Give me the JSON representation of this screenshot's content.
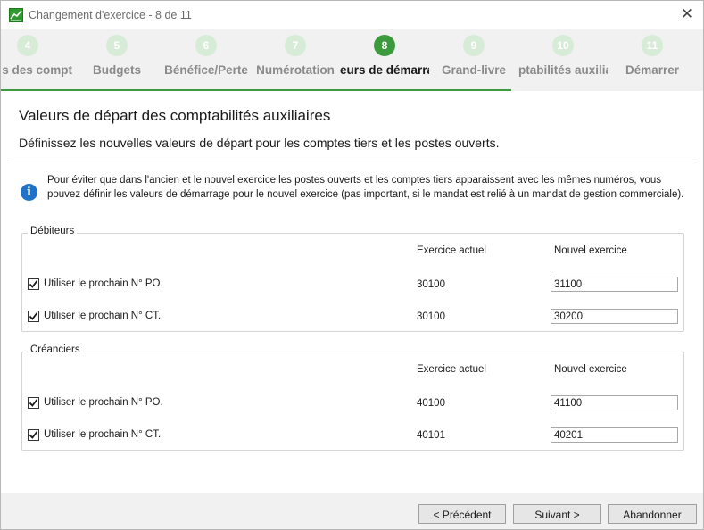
{
  "window": {
    "title": "Changement d'exercice - 8 de 11"
  },
  "steps": [
    {
      "number": "4",
      "label": "s des compt"
    },
    {
      "number": "5",
      "label": "Budgets"
    },
    {
      "number": "6",
      "label": "Bénéfice/Perte"
    },
    {
      "number": "7",
      "label": "Numérotation"
    },
    {
      "number": "8",
      "label": "eurs de démarra",
      "active": true
    },
    {
      "number": "9",
      "label": "Grand-livre"
    },
    {
      "number": "10",
      "label": "ptabilités auxilia"
    },
    {
      "number": "11",
      "label": "Démarrer"
    }
  ],
  "page": {
    "heading": "Valeurs de départ des comptabilités auxiliaires",
    "subheading": "Définissez les nouvelles valeurs de départ pour les comptes tiers et les postes ouverts.",
    "info": "Pour éviter que dans l'ancien et le nouvel exercice les postes ouverts et les comptes tiers apparaissent avec les mêmes numéros, vous pouvez définir les valeurs de démarrage pour le nouvel exercice (pas important, si le mandat est relié à un mandat de gestion commerciale)."
  },
  "debiteurs": {
    "title": "Débiteurs",
    "col_current": "Exercice actuel",
    "col_new": "Nouvel exercice",
    "rows": [
      {
        "label": "Utiliser le prochain N° PO.",
        "checked": true,
        "current": "30100",
        "new": "31100"
      },
      {
        "label": "Utiliser le prochain N° CT.",
        "checked": true,
        "current": "30100",
        "new": "30200"
      }
    ]
  },
  "creanciers": {
    "title": "Créanciers",
    "col_current": "Exercice actuel",
    "col_new": "Nouvel exercice",
    "rows": [
      {
        "label": "Utiliser le prochain N° PO.",
        "checked": true,
        "current": "40100",
        "new": "41100"
      },
      {
        "label": "Utiliser le prochain N° CT.",
        "checked": true,
        "current": "40101",
        "new": "40201"
      }
    ]
  },
  "buttons": {
    "previous": "< Précédent",
    "next": "Suivant >",
    "cancel": "Abandonner"
  },
  "icons": {
    "app": "chart-icon",
    "close": "close-icon",
    "info": "info-icon",
    "checkbox": "checkmark-icon"
  },
  "colors": {
    "accent": "#3c9a3c",
    "step_inactive": "#d7ecd7",
    "info_blue": "#1e73c8"
  }
}
